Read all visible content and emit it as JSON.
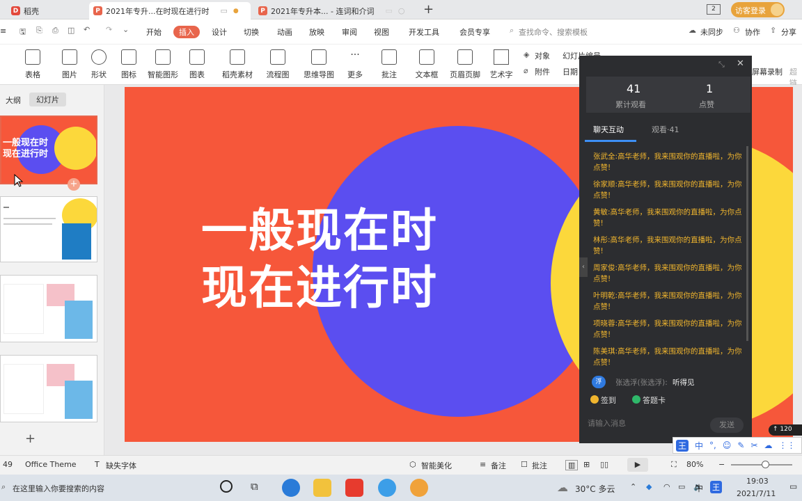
{
  "tabs": [
    {
      "label": "稻壳",
      "icon": "D",
      "color": "#e3483b"
    },
    {
      "label": "2021年专升...在时现在进行时",
      "icon": "P",
      "color": "#e8654c"
    },
    {
      "label": "2021年专升本... - 连词和介词",
      "icon": "P",
      "color": "#e8654c"
    }
  ],
  "tabbar": {
    "add": "+",
    "page_indicator": "2",
    "login": "访客登录"
  },
  "menu": {
    "items": [
      "开始",
      "插入",
      "设计",
      "切换",
      "动画",
      "放映",
      "审阅",
      "视图",
      "开发工具",
      "会员专享"
    ],
    "active": "插入",
    "search_placeholder": "查找命令、搜索模板",
    "sync": "未同步",
    "collab": "协作",
    "share": "分享"
  },
  "ribbon": {
    "items": [
      "表格",
      "图片",
      "形状",
      "图标",
      "智能图形",
      "图表",
      "稻壳素材",
      "流程图",
      "思维导图",
      "更多",
      "批注",
      "文本框",
      "页眉页脚",
      "艺术字"
    ],
    "side": [
      "对象",
      "附件",
      "幻灯片编号",
      "日期"
    ],
    "right": [
      "屏幕录制",
      "超链"
    ]
  },
  "leftpanel": {
    "tab_outline": "大纲",
    "tab_slides": "幻灯片",
    "thumb1_text": "一般现在时\n现在进行时",
    "add": "+"
  },
  "slide": {
    "line1": "一般现在时",
    "line2": "现在进行时"
  },
  "live": {
    "views_count": "41",
    "views_label": "累计观看",
    "likes_count": "1",
    "likes_label": "点赞",
    "tab_chat": "聊天互动",
    "tab_watch": "观看·41",
    "messages": [
      {
        "name": "张武全:",
        "text": "高华老师，我来围观你的直播啦，为你点赞!"
      },
      {
        "name": "徐家顺:",
        "text": "高华老师，我来围观你的直播啦，为你点赞!"
      },
      {
        "name": "黄敏:",
        "text": "高华老师，我来围观你的直播啦，为你点赞!"
      },
      {
        "name": "林彤:",
        "text": "高华老师，我来围观你的直播啦，为你点赞!"
      },
      {
        "name": "周家俊:",
        "text": "高华老师，我来围观你的直播啦，为你点赞!"
      },
      {
        "name": "叶明乾:",
        "text": "高华老师，我来围观你的直播啦，为你点赞!"
      },
      {
        "name": "项晓蓉:",
        "text": "高华老师，我来围观你的直播啦，为你点赞!"
      },
      {
        "name": "陈美琪:",
        "text": "高华老师，我来围观你的直播啦，为你点赞!"
      }
    ],
    "last_user": "张选浮(张选浮):",
    "last_msg": "听得见",
    "avatar": "浮",
    "checkin": "签到",
    "quiz": "答题卡",
    "input_placeholder": "请输入消息",
    "send": "发送",
    "speed": "120"
  },
  "ime": {
    "items": [
      "王",
      "中",
      "°,",
      "☺",
      "✎",
      "✂",
      "☁",
      "⋮⋮"
    ]
  },
  "statusbar": {
    "slide_no": "49",
    "theme": "Office Theme",
    "missing_font": "缺失字体",
    "beautify": "智能美化",
    "notes": "备注",
    "comment": "批注",
    "zoom": "80%"
  },
  "taskbar": {
    "search_placeholder": "在这里输入你要搜索的内容",
    "weather": "30°C 多云",
    "ime": "中",
    "time": "19:03",
    "date": "2021/7/11"
  }
}
